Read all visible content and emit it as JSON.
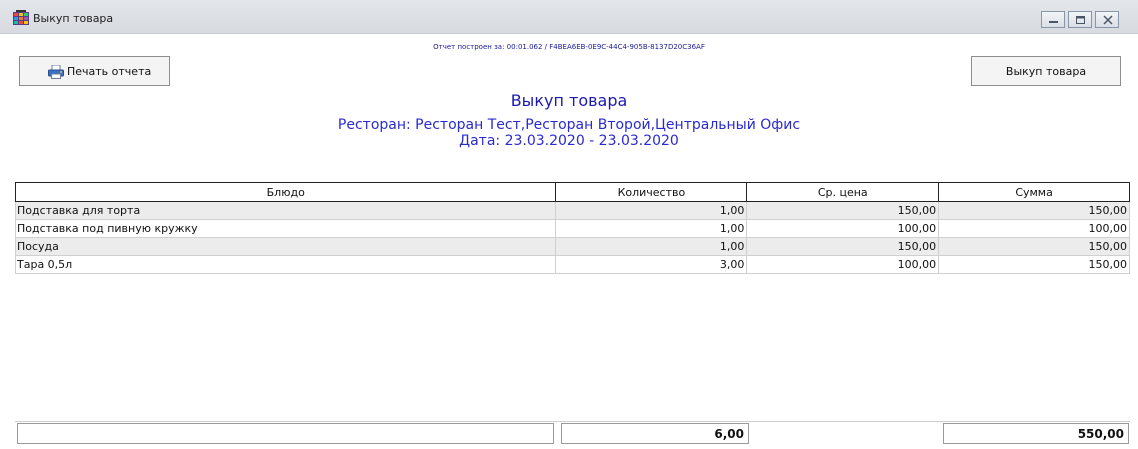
{
  "window": {
    "title": "Выкуп товара"
  },
  "build_info": "Отчет построен за: 00:01.062 / F4BEA6EB-0E9C-44C4-905B-8137D20C36AF",
  "toolbar": {
    "print_label": "Печать отчета",
    "buyout_label": "Выкуп товара"
  },
  "report": {
    "title": "Выкуп товара",
    "restaurants": "Ресторан: Ресторан Тест,Ресторан Второй,Центральный Офис",
    "date": "Дата: 23.03.2020 - 23.03.2020"
  },
  "table": {
    "headers": [
      "Блюдо",
      "Количество",
      "Ср. цена",
      "Сумма"
    ],
    "rows": [
      [
        "Подставка для торта",
        "1,00",
        "150,00",
        "150,00"
      ],
      [
        "Подставка под пивную кружку",
        "1,00",
        "100,00",
        "100,00"
      ],
      [
        "Посуда",
        "1,00",
        "150,00",
        "150,00"
      ],
      [
        "Тара 0,5л",
        "3,00",
        "100,00",
        "150,00"
      ]
    ]
  },
  "totals": {
    "quantity": "6,00",
    "sum": "550,00"
  },
  "icons": {
    "app": "grid-app-icon",
    "print": "printer-icon",
    "minimize": "minimize-icon",
    "maximize": "maximize-icon",
    "close": "close-icon"
  },
  "colors": {
    "title_blue": "#1b1bb0",
    "row_shade": "#ececec"
  }
}
